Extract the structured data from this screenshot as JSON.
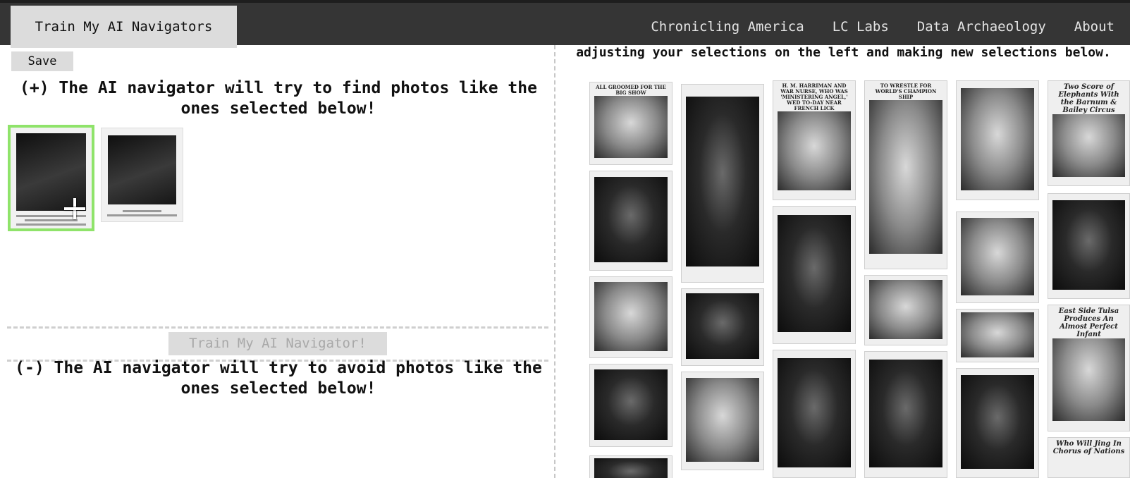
{
  "nav": {
    "brand": "Train My AI Navigators",
    "links": [
      "Chronicling America",
      "LC Labs",
      "Data Archaeology",
      "About"
    ]
  },
  "left": {
    "save_label": "Save",
    "positive_heading": "(+) The AI navigator will try to find photos like the ones selected below!",
    "train_label": "Train My AI Navigator!",
    "negative_heading": "(-) The AI navigator will try to avoid photos like the ones selected below!"
  },
  "right": {
    "instructions": "adjusting your selections on the left and making new selections below.",
    "captions": {
      "groomed": "ALL GROOMED FOR THE BIG SHOW",
      "harriman": "H. M. HARRIMAN AND WAR NURSE, WHO WAS 'MINISTERING ANGEL,' WED TO-DAY NEAR FRENCH LICK",
      "wrestle": "TO WRESTLE FOR WORLD'S CHAMPION SHIP",
      "elephants": "Two Score of Elephants With the Barnum & Bailey Circus",
      "tulsa": "East Side Tulsa Produces An Almost Perfect Infant",
      "jing": "Who Will Jing In Chorus of Nations"
    }
  },
  "colors": {
    "navbar": "#353535",
    "button_bg": "#dcdcdc",
    "selected_border": "#8fe36a"
  }
}
